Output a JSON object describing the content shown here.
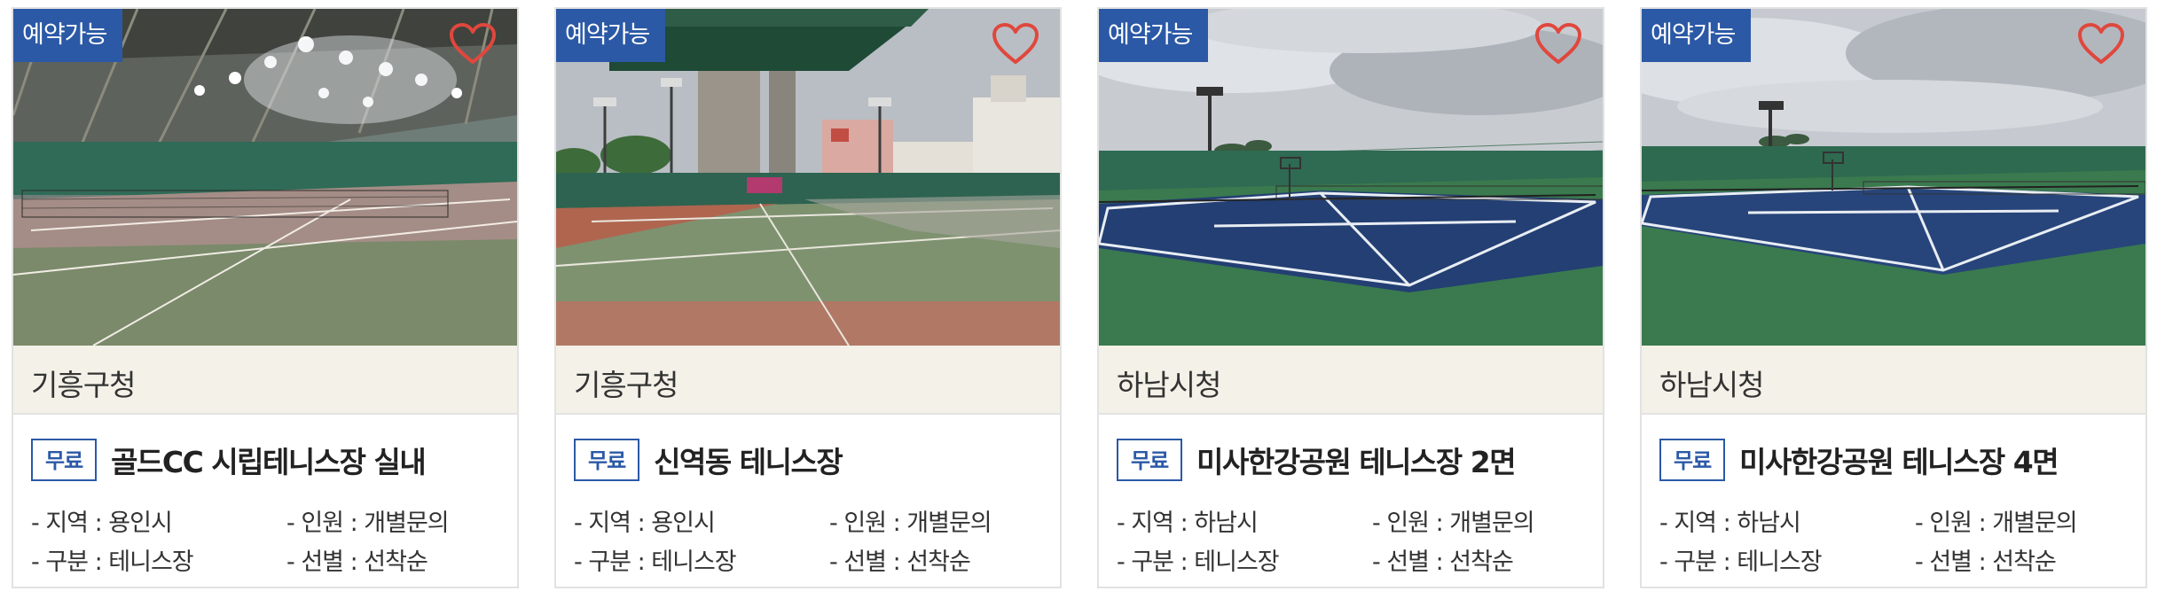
{
  "cards": [
    {
      "badge": "예약가능",
      "org": "기흥구청",
      "fee": "무료",
      "name": "골드CC 시립테니스장 실내",
      "region_label": "- 지역 : ",
      "region": "용인시",
      "capacity_label": "- 인원 : ",
      "capacity": "개별문의",
      "category_label": "- 구분 : ",
      "category": "테니스장",
      "selection_label": "- 선별 : ",
      "selection": "선착순",
      "photo": "indoor-court"
    },
    {
      "badge": "예약가능",
      "org": "기흥구청",
      "fee": "무료",
      "name": "신역동 테니스장",
      "region_label": "- 지역 : ",
      "region": "용인시",
      "capacity_label": "- 인원 : ",
      "capacity": "개별문의",
      "category_label": "- 구분 : ",
      "category": "테니스장",
      "selection_label": "- 선별 : ",
      "selection": "선착순",
      "photo": "under-bridge-court"
    },
    {
      "badge": "예약가능",
      "org": "하남시청",
      "fee": "무료",
      "name": "미사한강공원 테니스장 2면",
      "region_label": "- 지역 : ",
      "region": "하남시",
      "capacity_label": "- 인원 : ",
      "capacity": "개별문의",
      "category_label": "- 구분 : ",
      "category": "테니스장",
      "selection_label": "- 선별 : ",
      "selection": "선착순",
      "photo": "blue-hard-court"
    },
    {
      "badge": "예약가능",
      "org": "하남시청",
      "fee": "무료",
      "name": "미사한강공원 테니스장 4면",
      "region_label": "- 지역 : ",
      "region": "하남시",
      "capacity_label": "- 인원 : ",
      "capacity": "개별문의",
      "category_label": "- 구분 : ",
      "category": "테니스장",
      "selection_label": "- 선별 : ",
      "selection": "선착순",
      "photo": "blue-hard-court"
    }
  ],
  "colors": {
    "accent": "#2b59a6",
    "heart": "#e0473d",
    "org_bar": "#f3f1e8",
    "border": "#e2e2e2"
  },
  "icons": {
    "favorite": "heart-outline-icon"
  }
}
